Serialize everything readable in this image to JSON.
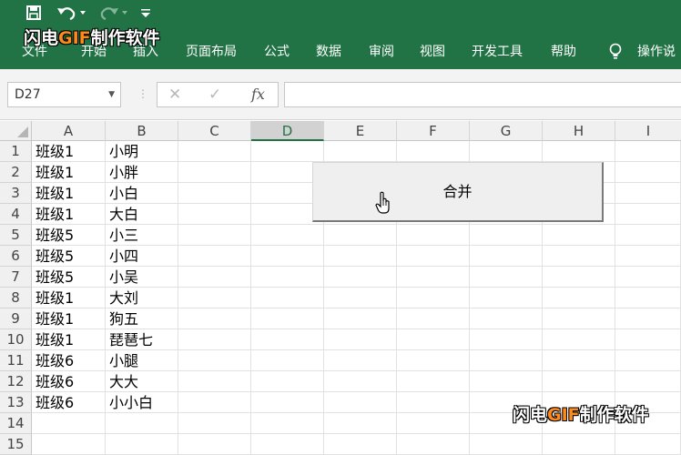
{
  "quick_access": {
    "save_icon": "save-icon",
    "undo_icon": "undo-icon",
    "redo_icon": "redo-icon",
    "customize_icon": "customize-icon"
  },
  "watermark": {
    "part1": "闪电",
    "part2": "GIF",
    "part3": "制作软件"
  },
  "ribbon_tabs": [
    "文件",
    "开始",
    "插入",
    "页面布局",
    "公式",
    "数据",
    "审阅",
    "视图",
    "开发工具",
    "帮助",
    "操作说"
  ],
  "formula_bar": {
    "name_box": "D27",
    "fx_label": "fx",
    "formula": ""
  },
  "columns": [
    "A",
    "B",
    "C",
    "D",
    "E",
    "F",
    "G",
    "H",
    "I"
  ],
  "rows": [
    "1",
    "2",
    "3",
    "4",
    "5",
    "6",
    "7",
    "8",
    "9",
    "10",
    "11",
    "12",
    "13",
    "14",
    "15"
  ],
  "sheet": {
    "col_a": [
      "班级1",
      "班级1",
      "班级1",
      "班级1",
      "班级5",
      "班级5",
      "班级5",
      "班级1",
      "班级1",
      "班级1",
      "班级6",
      "班级6",
      "班级6",
      "",
      ""
    ],
    "col_b": [
      "小明",
      "小胖",
      "小白",
      "大白",
      "小三",
      "小四",
      "小吴",
      "大刘",
      "狗五",
      "琵琶七",
      "小腿",
      "大大",
      "小小白",
      "",
      ""
    ]
  },
  "merge_button": {
    "label": "合并"
  },
  "colors": {
    "ribbon": "#217346",
    "watermark_accent": "#ff8a1c"
  }
}
